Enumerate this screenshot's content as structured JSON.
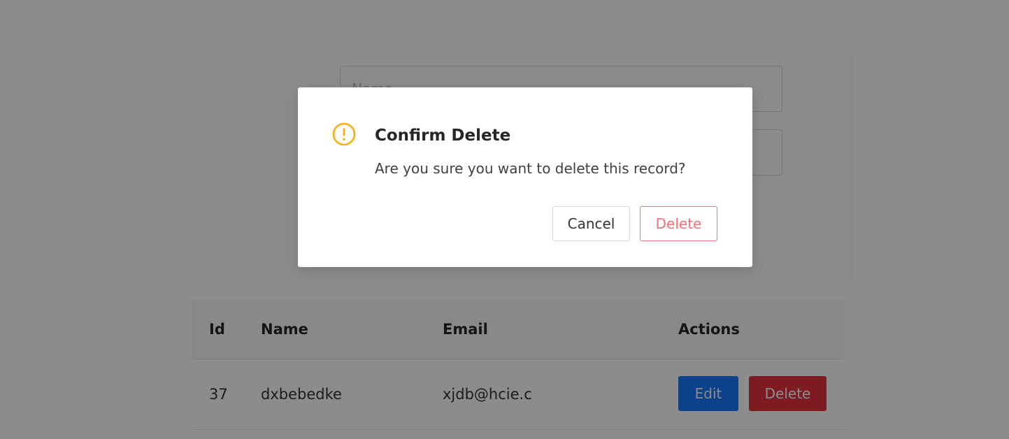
{
  "form": {
    "name_placeholder": "Name",
    "email_placeholder": ""
  },
  "table": {
    "headers": {
      "id": "Id",
      "name": "Name",
      "email": "Email",
      "actions": "Actions"
    },
    "rows": [
      {
        "id": "37",
        "name": "dxbebedke",
        "email": "xjdb@hcie.c",
        "edit_label": "Edit",
        "delete_label": "Delete"
      }
    ]
  },
  "modal": {
    "title": "Confirm Delete",
    "content": "Are you sure you want to delete this record?",
    "cancel_label": "Cancel",
    "confirm_label": "Delete",
    "icon": "exclamation-circle-icon"
  },
  "colors": {
    "warning": "#faad14",
    "primary": "#1677ff",
    "danger": "#e5323d",
    "danger_outline": "#f07178"
  }
}
